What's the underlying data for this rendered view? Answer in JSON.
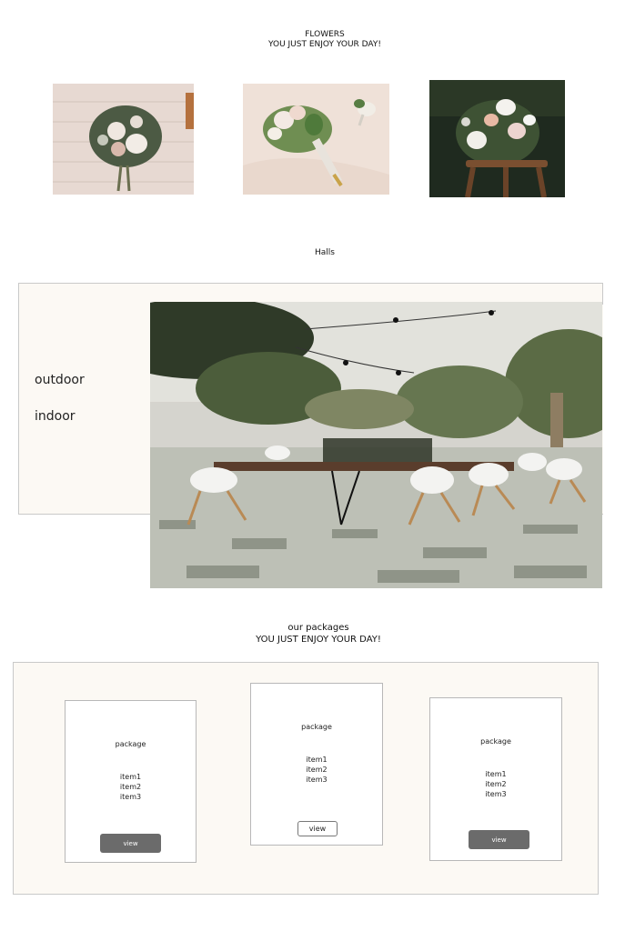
{
  "flowers": {
    "title": "FLOWERS",
    "subtitle": "YOU JUST ENJOY YOUR DAY!"
  },
  "halls": {
    "title": "Halls",
    "links": [
      "outdoor",
      "indoor"
    ]
  },
  "packages": {
    "title": "our packages",
    "subtitle": "YOU JUST ENJOY YOUR DAY!",
    "cards": [
      {
        "name": "package",
        "items": [
          "item1",
          "item2",
          "item3"
        ],
        "button": "view",
        "style": "dark"
      },
      {
        "name": "package",
        "items": [
          "item1",
          "item2",
          "item3"
        ],
        "button": "view",
        "style": "light"
      },
      {
        "name": "package",
        "items": [
          "item1",
          "item2",
          "item3"
        ],
        "button": "view",
        "style": "dark"
      }
    ]
  }
}
